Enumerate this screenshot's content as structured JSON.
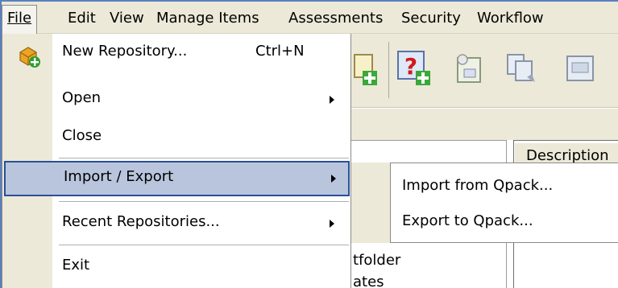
{
  "menubar": {
    "items": [
      {
        "label": "File"
      },
      {
        "label": "Edit"
      },
      {
        "label": "View"
      },
      {
        "label": "Manage Items"
      },
      {
        "label": "Assessments"
      },
      {
        "label": "Security"
      },
      {
        "label": "Workflow"
      }
    ]
  },
  "file_menu": {
    "items": [
      {
        "label": "New Repository...",
        "shortcut": "Ctrl+N",
        "icon": "new-repository-icon"
      },
      {
        "label": "Open"
      },
      {
        "label": "Close"
      },
      {
        "label": "Import / Export"
      },
      {
        "label": "Recent Repositories..."
      },
      {
        "label": "Exit"
      }
    ]
  },
  "import_export_submenu": {
    "items": [
      {
        "label": "Import from Qpack..."
      },
      {
        "label": "Export to Qpack..."
      }
    ]
  },
  "background": {
    "column_header": "Description",
    "tree_items": [
      "tfolder",
      "ates"
    ]
  },
  "colors": {
    "highlight": "#b9c5dd",
    "highlight_border": "#2a4f96",
    "menubar": "#ece9d8",
    "frame_border": "#5a7fbf"
  }
}
